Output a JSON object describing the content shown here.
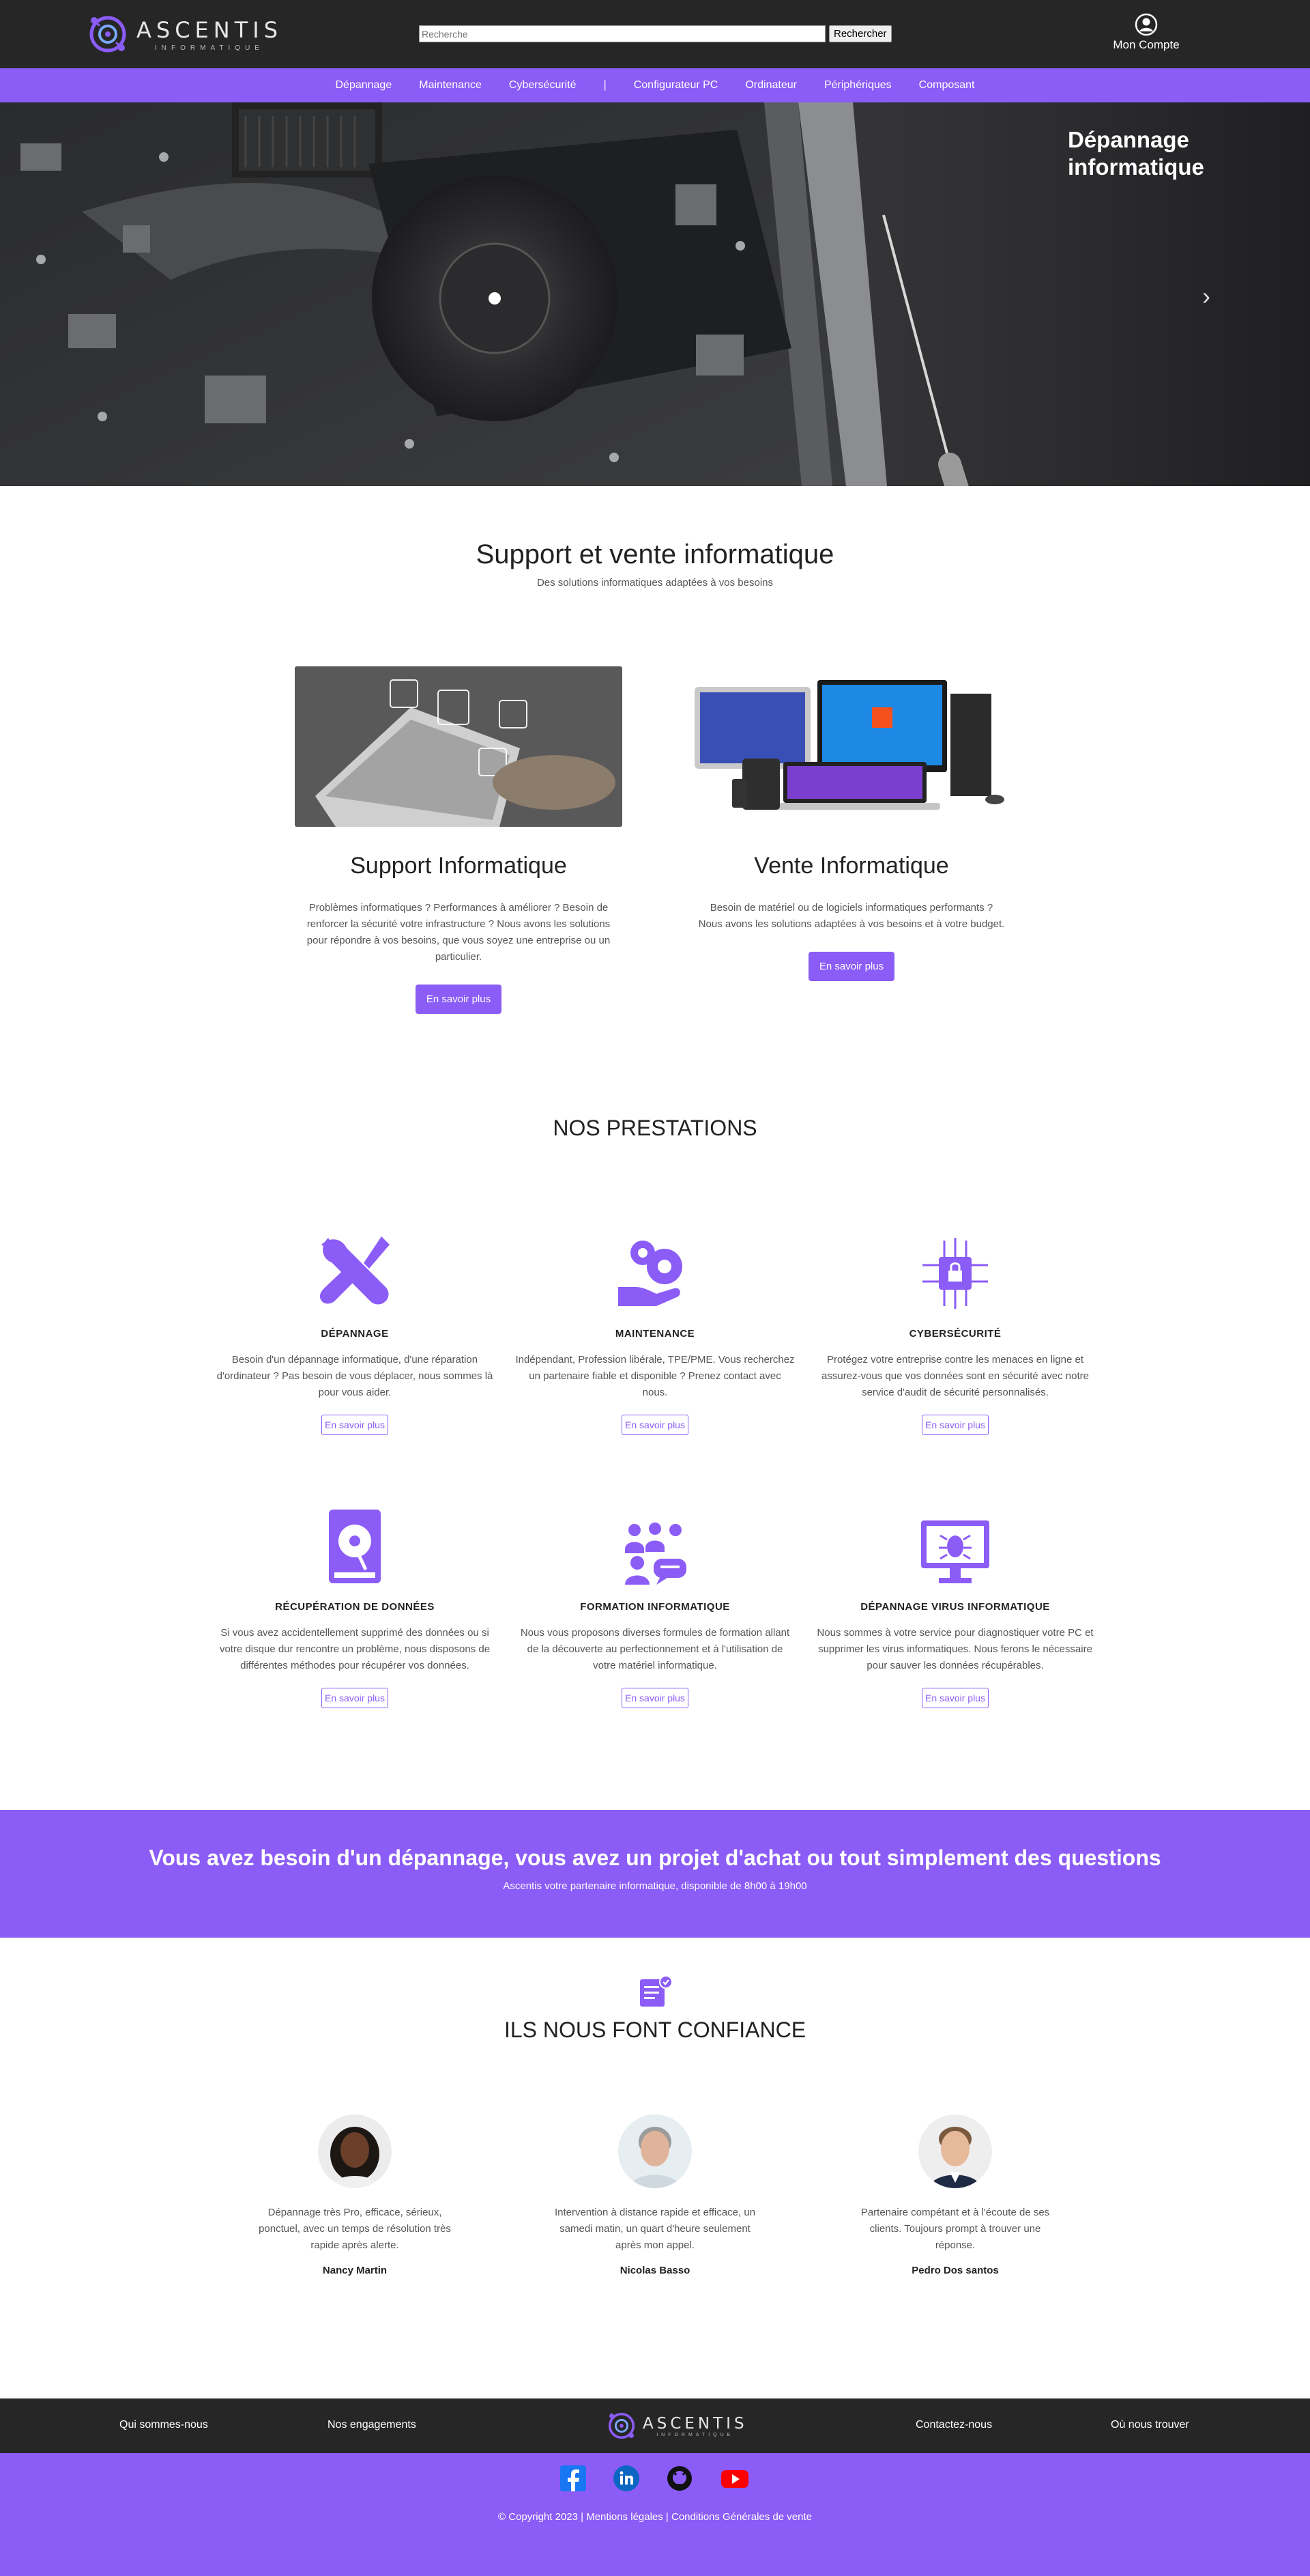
{
  "brand": {
    "name": "ASCENTIS",
    "tagline": "INFORMATIQUE"
  },
  "search": {
    "placeholder": "Recherche",
    "button": "Rechercher"
  },
  "account": {
    "label": "Mon Compte"
  },
  "nav": {
    "items": [
      "Dépannage",
      "Maintenance",
      "Cybersécurité",
      "|",
      "Configurateur PC",
      "Ordinateur",
      "Périphériques",
      "Composant"
    ]
  },
  "hero": {
    "title": "Dépannage informatique",
    "next_icon": "chevron-right-icon"
  },
  "intro": {
    "title": "Support et vente informatique",
    "subtitle": "Des solutions informatiques adaptées à vos besoins"
  },
  "cards": [
    {
      "title": "Support Informatique",
      "text": "Problèmes informatiques ? Performances à améliorer ? Besoin de renforcer la sécurité votre infrastructure ? Nous avons les solutions pour répondre à vos besoins, que vous soyez une entreprise ou un particulier.",
      "button": "En savoir plus"
    },
    {
      "title": "Vente Informatique",
      "text": "Besoin de matériel ou de logiciels informatiques performants ? Nous avons les solutions adaptées à vos besoins et à votre budget.",
      "button": "En savoir plus"
    }
  ],
  "prestations": {
    "title": "NOS PRESTATIONS",
    "items": [
      {
        "title": "DÉPANNAGE",
        "text": "Besoin d'un dépannage informatique, d'une réparation d'ordinateur ? Pas besoin de vous déplacer, nous sommes là pour vous aider.",
        "button": "En savoir plus",
        "icon": "wrench-screwdriver-icon"
      },
      {
        "title": "MAINTENANCE",
        "text": "Indépendant, Profession libérale, TPE/PME. Vous recherchez un partenaire fiable et disponible ? Prenez contact avec nous.",
        "button": "En savoir plus",
        "icon": "gear-hand-icon"
      },
      {
        "title": "CYBERSÉCURITÉ",
        "text": "Protégez votre entreprise contre les menaces en ligne et assurez-vous que vos données sont en sécurité avec notre service d'audit de sécurité personnalisés.",
        "button": "En savoir plus",
        "icon": "chip-lock-icon"
      },
      {
        "title": "RÉCUPÉRATION DE DONNÉES",
        "text": "Si vous avez accidentellement supprimé des données ou si votre disque dur rencontre un problème, nous disposons de différentes méthodes pour récupérer vos données.",
        "button": "En savoir plus",
        "icon": "hard-drive-icon"
      },
      {
        "title": "FORMATION INFORMATIQUE",
        "text": "Nous vous proposons diverses formules de formation allant de la découverte au perfectionnement et à l'utilisation de votre matériel informatique.",
        "button": "En savoir plus",
        "icon": "group-chat-icon"
      },
      {
        "title": "DÉPANNAGE VIRUS INFORMATIQUE",
        "text": "Nous sommes à votre service pour diagnostiquer votre PC et supprimer les virus informatiques. Nous ferons le nécessaire pour sauver les données récupérables.",
        "button": "En savoir plus",
        "icon": "monitor-bug-icon"
      }
    ]
  },
  "cta": {
    "title": "Vous avez besoin d'un dépannage, vous avez un projet d'achat ou tout simplement des questions",
    "subtitle": "Ascentis votre partenaire informatique, disponible de 8h00 à 19h00"
  },
  "testimonials": {
    "title": "ILS NOUS FONT CONFIANCE",
    "icon": "certificate-icon",
    "items": [
      {
        "text": "Dépannage très Pro, efficace, sérieux, ponctuel, avec un temps de résolution très rapide après alerte.",
        "name": "Nancy Martin"
      },
      {
        "text": "Intervention à distance rapide et efficace, un samedi matin, un quart d'heure seulement après mon appel.",
        "name": "Nicolas Basso"
      },
      {
        "text": "Partenaire compétant et à l'écoute de ses clients. Toujours prompt à trouver une réponse.",
        "name": "Pedro Dos santos"
      }
    ]
  },
  "footer": {
    "links": [
      "Qui sommes-nous",
      "Nos engagements",
      "Contactez-nous",
      "Où nous trouver"
    ],
    "socials": [
      "facebook-icon",
      "linkedin-icon",
      "github-icon",
      "youtube-icon"
    ],
    "copyright": "© Copyright 2023 | Mentions légales | Conditions Générales de vente"
  },
  "colors": {
    "accent": "#8b5cf6",
    "dark": "#262626"
  }
}
